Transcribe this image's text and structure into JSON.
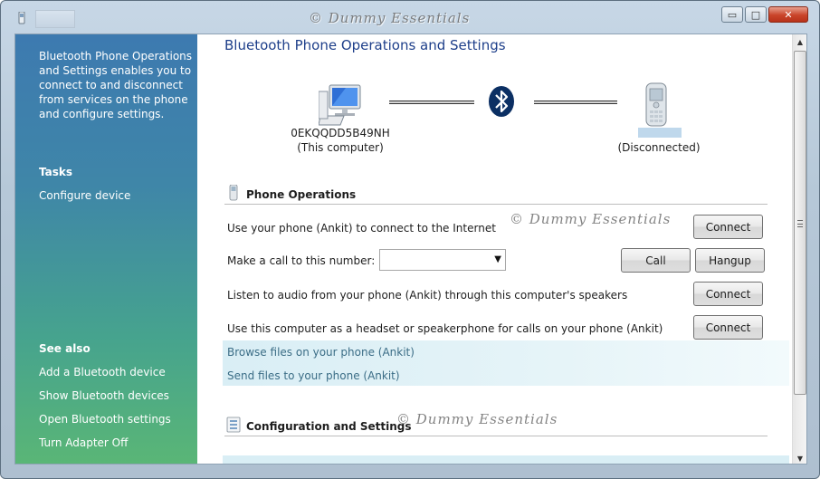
{
  "window": {
    "title_watermark": "© Dummy Essentials",
    "minimize": "▭",
    "maximize": "□",
    "close": "✕"
  },
  "sidebar": {
    "description": "Bluetooth Phone Operations and Settings enables you to connect to and disconnect from services on the phone and configure settings.",
    "tasks_heading": "Tasks",
    "tasks": [
      "Configure device"
    ],
    "see_also_heading": "See also",
    "see_also": [
      "Add a Bluetooth device",
      "Show Bluetooth devices",
      "Open Bluetooth settings",
      "Turn Adapter Off"
    ]
  },
  "main": {
    "title": "Bluetooth Phone Operations and Settings",
    "computer_name": "0EKQQDD5B49NH",
    "computer_sub": "(This computer)",
    "phone_status": "(Disconnected)",
    "phone_ops_heading": "Phone Operations",
    "rows": [
      {
        "text": "Use your phone (Ankit) to connect to the Internet",
        "button": "Connect"
      },
      {
        "text": "Make a call to this number:",
        "call": "Call",
        "hangup": "Hangup",
        "number_value": ""
      },
      {
        "text": "Listen to audio from your phone (Ankit) through this computer's speakers",
        "button": "Connect"
      },
      {
        "text": "Use this computer as a headset or speakerphone for calls on your phone (Ankit)",
        "button": "Connect"
      }
    ],
    "links": [
      "Browse files on your phone (Ankit)",
      "Send files to your phone (Ankit)"
    ],
    "config_heading": "Configuration and Settings"
  },
  "watermarks": [
    "© Dummy Essentials",
    "© Dummy Essentials"
  ],
  "colors": {
    "title_blue": "#1e3f8a",
    "sidebar_top": "#3d7ab0",
    "sidebar_bottom": "#5ab676",
    "link_band": "#d9eef5"
  },
  "icons": {
    "computer": "computer-icon",
    "bluetooth": "bluetooth-icon",
    "phone": "mobile-phone-icon",
    "phone_ops": "phone-operations-icon",
    "config": "settings-list-icon"
  }
}
